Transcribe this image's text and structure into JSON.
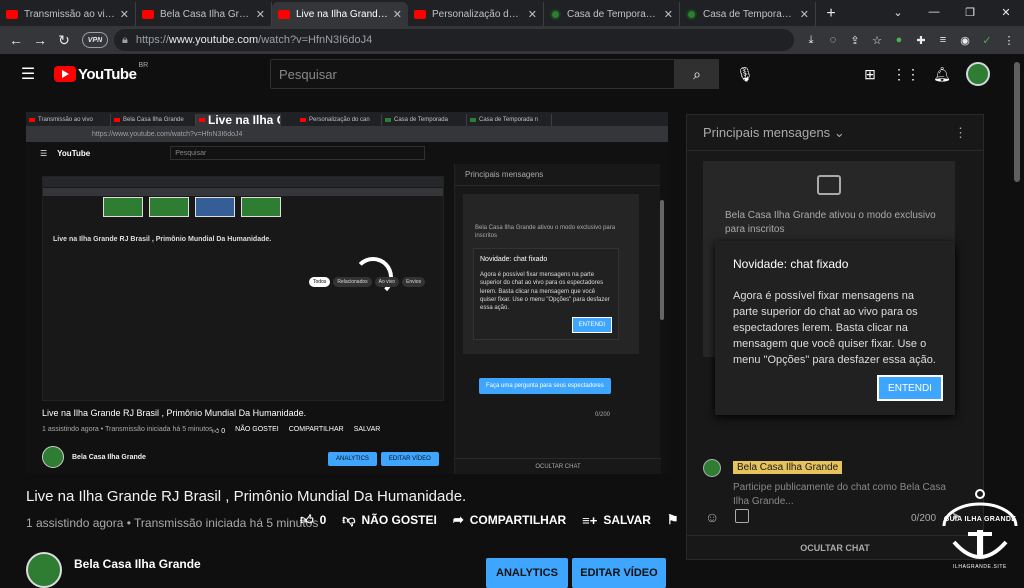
{
  "browser": {
    "tabs": [
      {
        "label": "Transmissão ao vivo -",
        "favicon": "youtube-icon",
        "active": false
      },
      {
        "label": "Bela Casa Ilha Grande",
        "favicon": "youtube-icon",
        "active": false
      },
      {
        "label": "Live na Ilha Grande R",
        "favicon": "youtube-icon",
        "active": true
      },
      {
        "label": "Personalização do can",
        "favicon": "youtube-icon",
        "active": false
      },
      {
        "label": "Casa de Temporada n",
        "favicon": "site-icon",
        "active": false
      },
      {
        "label": "Casa de Temporada n",
        "favicon": "site-icon",
        "active": false
      }
    ],
    "vpn_label": "VPN",
    "url_prefix": "https://",
    "url_host": "www.youtube.com",
    "url_path": "/watch?v=HfnN3I6doJ4"
  },
  "youtube": {
    "logo": "YouTube",
    "country": "BR",
    "search_placeholder": "Pesquisar"
  },
  "inner": {
    "tabs": [
      "Transmissão ao vivo",
      "Bela Casa Ilha Grande",
      "Live na Ilha Grande RJ",
      "Personalização do can",
      "Casa de Temporada",
      "Casa de Temporada n"
    ],
    "url": "https://www.youtube.com/watch?v=HfnN3I6doJ4",
    "logo": "YouTube",
    "search_placeholder": "Pesquisar",
    "nested_title": "Live na Ilha Grande RJ Brasil , Primônio Mundial Da Humanidade.",
    "chips": [
      "Todos",
      "Relacionados",
      "Ao vivo",
      "Envios"
    ],
    "title": "Live na Ilha Grande RJ Brasil , Primônio Mundial Da Humanidade.",
    "meta": "1 assistindo agora • Transmissão iniciada há 5 minutos",
    "like_count": "0",
    "dislike": "NÃO GOSTEI",
    "share": "COMPARTILHAR",
    "save": "SALVAR",
    "channel": "Bela Casa Ilha Grande",
    "analytics": "ANALYTICS",
    "edit": "EDITAR VÍDEO",
    "chat_header": "Principais mensagens",
    "chat_card": "Bela Casa Ilha Grande ativou o modo exclusivo para inscritos",
    "popup_title": "Novidade: chat fixado",
    "popup_body": "Agora é possível fixar mensagens na parte superior do chat ao vivo para os espectadores lerem. Basta clicar na mensagem que você quiser fixar. Use o menu \"Opções\" para desfazer essa ação.",
    "popup_button": "ENTENDI",
    "tip": "Faça uma pergunta para seus espectadores",
    "counter": "0/200",
    "hide_chat": "OCULTAR CHAT"
  },
  "video": {
    "title": "Live na Ilha Grande RJ Brasil , Primônio Mundial Da Humanidade.",
    "meta": "1 assistindo agora • Transmissão iniciada há 5 minutos",
    "like_count": "0",
    "dislike_label": "NÃO GOSTEI",
    "share_label": "COMPARTILHAR",
    "save_label": "SALVAR",
    "channel_name": "Bela Casa Ilha Grande",
    "analytics_label": "ANALYTICS",
    "edit_label": "EDITAR VÍDEO"
  },
  "chat": {
    "header": "Principais mensagens",
    "card_text": "Bela Casa Ilha Grande ativou o modo exclusivo para inscritos",
    "popup_title": "Novidade: chat fixado",
    "popup_body": "Agora é possível fixar mensagens na parte superior do chat ao vivo para os espectadores lerem. Basta clicar na mensagem que você quiser fixar. Use o menu \"Opções\" para desfazer essa ação.",
    "popup_button": "ENTENDI",
    "user_name": "Bela Casa Ilha Grande",
    "input_placeholder": "Participe publicamente do chat como Bela Casa Ilha Grande...",
    "counter": "0/200",
    "hide_label": "OCULTAR CHAT"
  },
  "watermark": {
    "title": "GUIA ILHA GRANDE",
    "subtitle": "ILHAGRANDE.SITE"
  },
  "colors": {
    "accent": "#3ea6ff",
    "youtube_red": "#ff0000",
    "background": "#0f0f0f",
    "panel": "#181818",
    "badge": "#e6c35c"
  }
}
